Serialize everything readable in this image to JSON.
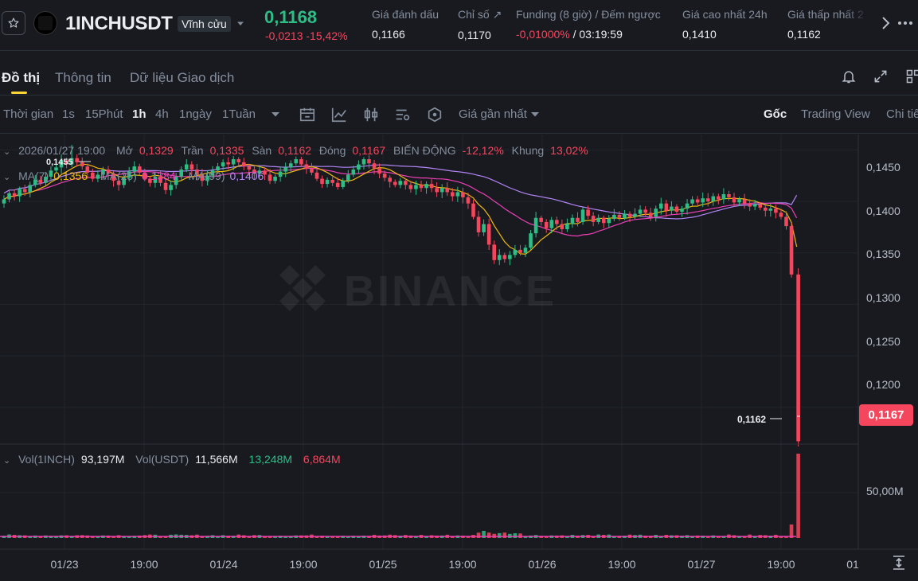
{
  "header": {
    "symbol": "1INCHUSDT",
    "contract_type": "Vĩnh cửu",
    "last_price": "0,1168",
    "change_abs": "-0,0213",
    "change_pct": "-15,42%",
    "stats": [
      {
        "label": "Giá đánh dấu",
        "value": "0,1166"
      },
      {
        "label": "Chỉ số ↗",
        "value": "0,1170"
      },
      {
        "label": "Funding (8 giờ) / Đếm ngược",
        "value_neg": "-0,01000%",
        "value": " / 03:19:59"
      },
      {
        "label": "Giá cao nhất 24h",
        "value": "0,1410"
      },
      {
        "label": "Giá thấp nhất 2",
        "value": "0,1162"
      }
    ]
  },
  "tabs": [
    "Đồ thị",
    "Thông tin",
    "Dữ liệu Giao dịch"
  ],
  "toolbar": {
    "time_label": "Thời gian",
    "intervals": [
      "1s",
      "15Phút",
      "1h",
      "4h",
      "1ngày",
      "1Tuần"
    ],
    "active_interval": "1h",
    "price_source": "Giá gần nhất",
    "views": [
      "Gốc",
      "Trading View",
      "Chi tiế"
    ]
  },
  "ohlc": {
    "date": "2026/01/27 19:00",
    "open_label": "Mở",
    "open": "0,1329",
    "high_label": "Trần",
    "high": "0,1335",
    "low_label": "Sàn",
    "low": "0,1162",
    "close_label": "Đóng",
    "close": "0,1167",
    "change_label": "BIẾN ĐỘNG",
    "change": "-12,12%",
    "range_label": "Khung",
    "range": "13,02%"
  },
  "ma": {
    "ma7_label": "MA(7)",
    "ma7": "0,1356",
    "ma25_label": "MA(25)",
    "ma25": "0,1384",
    "ma99_label": "MA(99)",
    "ma99": "0,1406"
  },
  "volume": {
    "coin_label": "Vol(1INCH)",
    "coin": "93,197M",
    "usdt_label": "Vol(USDT)",
    "usdt": "11,566M",
    "buy": "13,248M",
    "sell": "6,864M"
  },
  "price_axis": [
    "0,1450",
    "0,1400",
    "0,1350",
    "0,1300",
    "0,1250",
    "0,1200"
  ],
  "volume_axis": [
    "50,00M"
  ],
  "time_axis": [
    "01/23",
    "19:00",
    "01/24",
    "19:00",
    "01/25",
    "19:00",
    "01/26",
    "19:00",
    "01/27",
    "19:00",
    "01"
  ],
  "high_marker": "0,1455",
  "low_marker": "0,1162",
  "current_price_tag": "0,1167",
  "watermark": "BINANCE",
  "colors": {
    "up": "#2ebd85",
    "down": "#f6465d",
    "accent": "#fcd535",
    "ma7": "#f0b90b",
    "ma25": "#eb40b5",
    "ma99": "#b385f6"
  },
  "chart_data": {
    "type": "candlestick",
    "interval": "1h",
    "price_range": [
      0.1165,
      0.1465
    ],
    "close_path": [
      0.1402,
      0.1408,
      0.1405,
      0.1412,
      0.1409,
      0.1416,
      0.1421,
      0.1418,
      0.1424,
      0.143,
      0.1433,
      0.144,
      0.1436,
      0.1442,
      0.1438,
      0.1434,
      0.1428,
      0.1422,
      0.1426,
      0.1431,
      0.1427,
      0.142,
      0.1416,
      0.1423,
      0.1429,
      0.1434,
      0.1428,
      0.1422,
      0.1418,
      0.1424,
      0.1418,
      0.1411,
      0.1416,
      0.1424,
      0.1431,
      0.1436,
      0.1431,
      0.1426,
      0.142,
      0.1425,
      0.143,
      0.1434,
      0.1438,
      0.1436,
      0.1441,
      0.1438,
      0.1434,
      0.1431,
      0.1427,
      0.143,
      0.1426,
      0.142,
      0.1424,
      0.1429,
      0.1433,
      0.1437,
      0.1441,
      0.1436,
      0.1432,
      0.1428,
      0.1422,
      0.1417,
      0.1421,
      0.1418,
      0.1414,
      0.142,
      0.1426,
      0.1431,
      0.1436,
      0.1441,
      0.1437,
      0.1432,
      0.1427,
      0.1423,
      0.1419,
      0.1416,
      0.142,
      0.1416,
      0.1412,
      0.1416,
      0.1413,
      0.1417,
      0.1413,
      0.1409,
      0.1413,
      0.1409,
      0.1405,
      0.1409,
      0.1404,
      0.1398,
      0.1385,
      0.137,
      0.1378,
      0.1358,
      0.1343,
      0.1348,
      0.1344,
      0.1348,
      0.1353,
      0.135,
      0.1355,
      0.1369,
      0.1384,
      0.138,
      0.1374,
      0.1382,
      0.1378,
      0.1373,
      0.1378,
      0.1384,
      0.138,
      0.1392,
      0.1386,
      0.138,
      0.1384,
      0.1379,
      0.1383,
      0.1387,
      0.1384,
      0.1388,
      0.1385,
      0.1388,
      0.1392,
      0.1389,
      0.1385,
      0.1393,
      0.1398,
      0.1391,
      0.1395,
      0.139,
      0.1393,
      0.1398,
      0.1402,
      0.1399,
      0.1403,
      0.14,
      0.1405,
      0.1402,
      0.1407,
      0.1404,
      0.1399,
      0.1402,
      0.1398,
      0.1395,
      0.1397,
      0.1394,
      0.1391,
      0.1393,
      0.1389,
      0.1385,
      0.1376,
      0.1329,
      0.1167
    ],
    "last_candle": {
      "open": 0.1329,
      "high": 0.1335,
      "low": 0.1162,
      "close": 0.1167
    }
  }
}
